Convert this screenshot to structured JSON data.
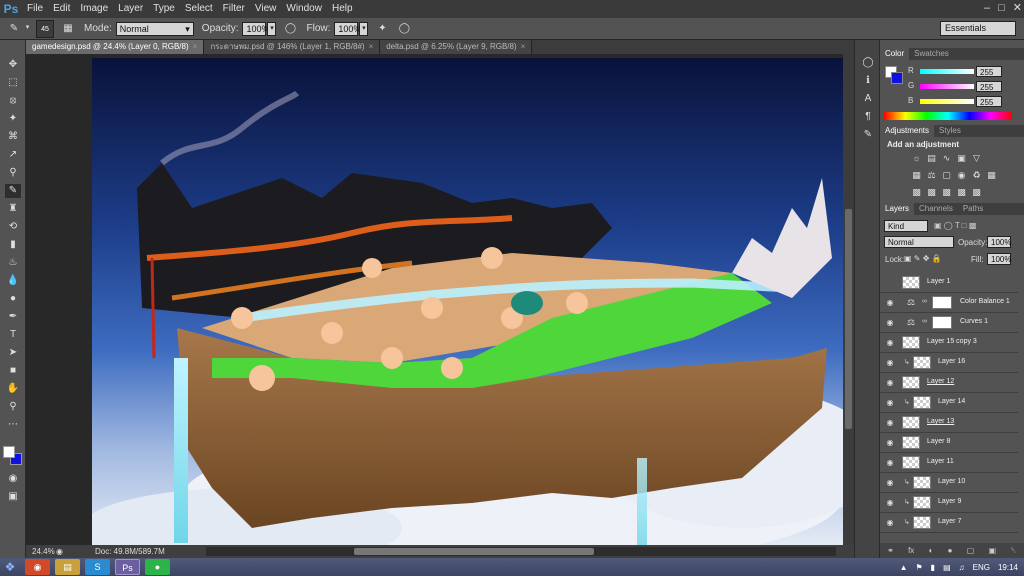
{
  "app": {
    "logo": "Ps"
  },
  "menu": [
    "File",
    "Edit",
    "Image",
    "Layer",
    "Type",
    "Select",
    "Filter",
    "View",
    "Window",
    "Help"
  ],
  "window_controls": [
    "–",
    "□",
    "✕"
  ],
  "options": {
    "brush_size": "45",
    "mode_label": "Mode:",
    "mode_value": "Normal",
    "opacity_label": "Opacity:",
    "opacity_value": "100%",
    "flow_label": "Flow:",
    "flow_value": "100%",
    "workspace": "Essentials"
  },
  "tabs": [
    {
      "label": "gamedesign.psd @ 24.4% (Layer 0, RGB/8)",
      "close": "×",
      "active": true
    },
    {
      "label": "กระดาษพม.psd @ 146% (Layer 1, RGB/8#)",
      "close": "×",
      "active": false
    },
    {
      "label": "delta.psd @ 6.25% (Layer 9, RGB/8)",
      "close": "×",
      "active": false
    }
  ],
  "status": {
    "zoom": "24.4%",
    "doc": "Doc: 49.8M/589.7M",
    "scroll_fraction": 0.38
  },
  "color_panel": {
    "tabs": [
      "Color",
      "Swatches"
    ],
    "channels": [
      {
        "label": "R",
        "value": "255",
        "gradient": "linear-gradient(90deg,#00ffff,#ffffff)"
      },
      {
        "label": "G",
        "value": "255",
        "gradient": "linear-gradient(90deg,#ff00ff,#ffffff)"
      },
      {
        "label": "B",
        "value": "255",
        "gradient": "linear-gradient(90deg,#ffff00,#ffffff)"
      }
    ],
    "foreground": "#ffffff",
    "background": "#1010e0"
  },
  "adjustments": {
    "tabs": [
      "Adjustments",
      "Styles"
    ],
    "title": "Add an adjustment"
  },
  "layers_panel": {
    "tabs": [
      "Layers",
      "Channels",
      "Paths"
    ],
    "kind": "Kind",
    "blend_mode": "Normal",
    "opacity_label": "Opacity:",
    "opacity_value": "100%",
    "lock_label": "Lock:",
    "fill_label": "Fill:",
    "fill_value": "100%",
    "layers": [
      {
        "name": "Layer 1",
        "visible": false,
        "type": "pixel"
      },
      {
        "name": "Color Balance 1",
        "visible": true,
        "type": "adjustment"
      },
      {
        "name": "Curves 1",
        "visible": true,
        "type": "adjustment"
      },
      {
        "name": "Layer 15 copy 3",
        "visible": true,
        "type": "pixel"
      },
      {
        "name": "Layer 16",
        "visible": true,
        "type": "clipped"
      },
      {
        "name": "Layer 12",
        "visible": true,
        "type": "linked"
      },
      {
        "name": "Layer 14",
        "visible": true,
        "type": "clipped"
      },
      {
        "name": "Layer 13",
        "visible": true,
        "type": "linked"
      },
      {
        "name": "Layer 8",
        "visible": true,
        "type": "pixel"
      },
      {
        "name": "Layer 11",
        "visible": true,
        "type": "pixel"
      },
      {
        "name": "Layer 10",
        "visible": true,
        "type": "clipped"
      },
      {
        "name": "Layer 9",
        "visible": true,
        "type": "clipped"
      },
      {
        "name": "Layer 7",
        "visible": true,
        "type": "clipped"
      }
    ],
    "footer_icons": [
      "⚭",
      "fx",
      "◐",
      "●",
      "▢",
      "▣",
      "␡"
    ]
  },
  "taskbar": {
    "tray_lang": "ENG",
    "clock": "19:14"
  }
}
